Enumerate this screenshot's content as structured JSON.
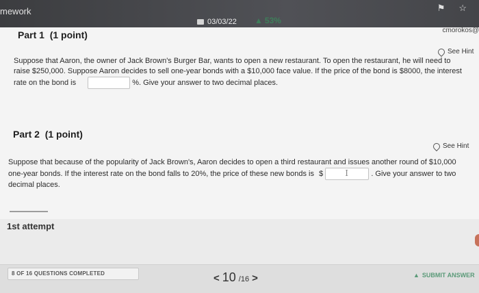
{
  "header": {
    "app_title": "mework",
    "date": "03/03/22",
    "progress": "53%",
    "user": "cmorokos@"
  },
  "part1": {
    "title": "Part 1",
    "points": "(1 point)",
    "hint_label": "See Hint",
    "text_line1": "Suppose that Aaron, the owner of Jack Brown's Burger Bar, wants to open a new restaurant. To open the restaurant, he will need to",
    "text_line2": "raise $250,000. Suppose Aaron decides to sell one-year bonds with a $10,000 face value. If the price of the bond is $8000, the interest",
    "text_line3a": "rate on the bond is",
    "text_line3b": "%. Give your answer to two decimal places."
  },
  "part2": {
    "title": "Part 2",
    "points": "(1 point)",
    "hint_label": "See Hint",
    "text_line1": "Suppose that because of the popularity of Jack Brown's, Aaron decides to open a third restaurant and issues another round of $10,000",
    "text_line2a": "one-year bonds. If the interest rate on the bond falls to 20%, the price of these new bonds is",
    "currency": "$",
    "text_line2b": ". Give your answer to two",
    "text_line3": "decimal places."
  },
  "attempt_label": "1st attempt",
  "footer": {
    "completed": "8 OF 16 QUESTIONS COMPLETED",
    "current_page": "10",
    "total_pages": "/16",
    "submit_label": "SUBMIT ANSWER"
  }
}
